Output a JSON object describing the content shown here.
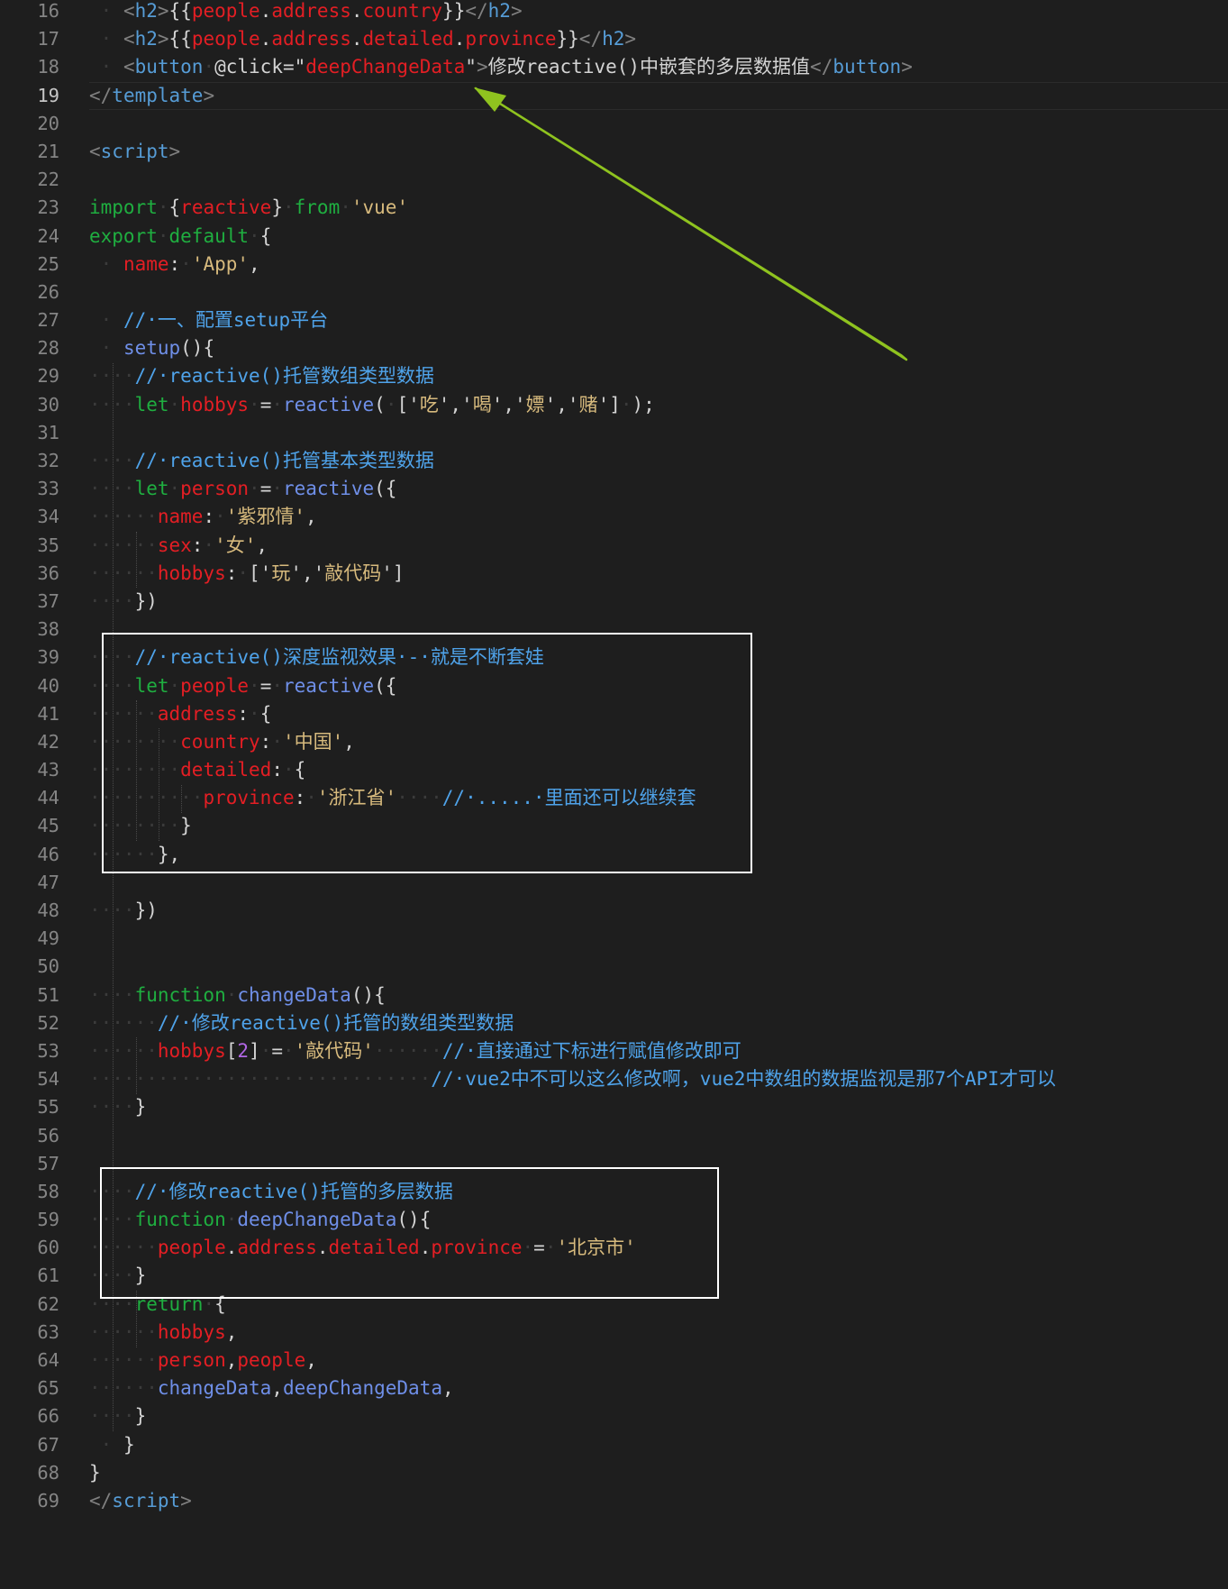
{
  "editor": {
    "lines": [
      {
        "n": "16",
        "t": [
          [
            "ws",
            " · "
          ],
          [
            "tag",
            "<"
          ],
          [
            "tn",
            "h2"
          ],
          [
            "tag",
            ">"
          ],
          [
            "pl",
            "{{"
          ],
          [
            "var",
            "people"
          ],
          [
            "pl",
            "."
          ],
          [
            "var",
            "address"
          ],
          [
            "pl",
            "."
          ],
          [
            "var",
            "country"
          ],
          [
            "pl",
            "}}"
          ],
          [
            "tag",
            "</"
          ],
          [
            "tn",
            "h2"
          ],
          [
            "tag",
            ">"
          ]
        ]
      },
      {
        "n": "17",
        "t": [
          [
            "ws",
            " · "
          ],
          [
            "tag",
            "<"
          ],
          [
            "tn",
            "h2"
          ],
          [
            "tag",
            ">"
          ],
          [
            "pl",
            "{{"
          ],
          [
            "var",
            "people"
          ],
          [
            "pl",
            "."
          ],
          [
            "var",
            "address"
          ],
          [
            "pl",
            "."
          ],
          [
            "var",
            "detailed"
          ],
          [
            "pl",
            "."
          ],
          [
            "var",
            "province"
          ],
          [
            "pl",
            "}}"
          ],
          [
            "tag",
            "</"
          ],
          [
            "tn",
            "h2"
          ],
          [
            "tag",
            ">"
          ]
        ]
      },
      {
        "n": "18",
        "t": [
          [
            "ws",
            " · "
          ],
          [
            "tag",
            "<"
          ],
          [
            "tn",
            "button"
          ],
          [
            "ws",
            "·"
          ],
          [
            "pl",
            "@click="
          ],
          [
            "pl",
            "\""
          ],
          [
            "var",
            "deepChangeData"
          ],
          [
            "pl",
            "\""
          ],
          [
            "tag",
            ">"
          ],
          [
            "txt",
            "修改reactive()中嵌套的多层数据值"
          ],
          [
            "tag",
            "</"
          ],
          [
            "tn",
            "button"
          ],
          [
            "tag",
            ">"
          ]
        ]
      },
      {
        "n": "19",
        "current": true,
        "t": [
          [
            "tag",
            "</"
          ],
          [
            "tn",
            "template"
          ],
          [
            "tag",
            ">"
          ]
        ]
      },
      {
        "n": "20",
        "t": []
      },
      {
        "n": "21",
        "t": [
          [
            "tag",
            "<"
          ],
          [
            "tn",
            "script"
          ],
          [
            "tag",
            ">"
          ]
        ]
      },
      {
        "n": "22",
        "t": []
      },
      {
        "n": "23",
        "t": [
          [
            "kw",
            "import"
          ],
          [
            "ws",
            "·"
          ],
          [
            "pl",
            "{"
          ],
          [
            "var",
            "reactive"
          ],
          [
            "pl",
            "}"
          ],
          [
            "ws",
            "·"
          ],
          [
            "kw",
            "from"
          ],
          [
            "ws",
            "·"
          ],
          [
            "str",
            "'vue'"
          ]
        ]
      },
      {
        "n": "24",
        "t": [
          [
            "kw",
            "export"
          ],
          [
            "ws",
            "·"
          ],
          [
            "kw",
            "default"
          ],
          [
            "ws",
            "·"
          ],
          [
            "pl",
            "{"
          ]
        ]
      },
      {
        "n": "25",
        "t": [
          [
            "ws",
            " · "
          ],
          [
            "var",
            "name"
          ],
          [
            "pl",
            ":"
          ],
          [
            "ws",
            "·"
          ],
          [
            "str",
            "'App'"
          ],
          [
            "pl",
            ","
          ]
        ]
      },
      {
        "n": "26",
        "t": []
      },
      {
        "n": "27",
        "t": [
          [
            "ws",
            " · "
          ],
          [
            "cm",
            "//·一、配置setup平台"
          ]
        ]
      },
      {
        "n": "28",
        "t": [
          [
            "ws",
            " · "
          ],
          [
            "fn",
            "setup"
          ],
          [
            "pl",
            "(){"
          ]
        ]
      },
      {
        "n": "29",
        "t": [
          [
            "ws",
            "····"
          ],
          [
            "cm",
            "//·reactive()托管数组类型数据"
          ]
        ]
      },
      {
        "n": "30",
        "t": [
          [
            "ws",
            "····"
          ],
          [
            "kw",
            "let"
          ],
          [
            "ws",
            "·"
          ],
          [
            "var",
            "hobbys"
          ],
          [
            "ws",
            "·"
          ],
          [
            "pl",
            "="
          ],
          [
            "ws",
            "·"
          ],
          [
            "fn",
            "reactive"
          ],
          [
            "pl",
            "("
          ],
          [
            "ws",
            "·"
          ],
          [
            "pl",
            "['"
          ],
          [
            "str",
            "吃"
          ],
          [
            "pl",
            "','"
          ],
          [
            "str",
            "喝"
          ],
          [
            "pl",
            "','"
          ],
          [
            "str",
            "嫖"
          ],
          [
            "pl",
            "','"
          ],
          [
            "str",
            "赌"
          ],
          [
            "pl",
            "']"
          ],
          [
            "ws",
            "·"
          ],
          [
            "pl",
            ");"
          ]
        ]
      },
      {
        "n": "31",
        "t": []
      },
      {
        "n": "32",
        "t": [
          [
            "ws",
            "····"
          ],
          [
            "cm",
            "//·reactive()托管基本类型数据"
          ]
        ]
      },
      {
        "n": "33",
        "t": [
          [
            "ws",
            "····"
          ],
          [
            "kw",
            "let"
          ],
          [
            "ws",
            "·"
          ],
          [
            "var",
            "person"
          ],
          [
            "ws",
            "·"
          ],
          [
            "pl",
            "="
          ],
          [
            "ws",
            "·"
          ],
          [
            "fn",
            "reactive"
          ],
          [
            "pl",
            "({"
          ]
        ]
      },
      {
        "n": "34",
        "t": [
          [
            "ws",
            "······"
          ],
          [
            "var",
            "name"
          ],
          [
            "pl",
            ":"
          ],
          [
            "ws",
            "·"
          ],
          [
            "str",
            "'紫邪情'"
          ],
          [
            "pl",
            ","
          ]
        ]
      },
      {
        "n": "35",
        "t": [
          [
            "ws",
            "······"
          ],
          [
            "var",
            "sex"
          ],
          [
            "pl",
            ":"
          ],
          [
            "ws",
            "·"
          ],
          [
            "str",
            "'女'"
          ],
          [
            "pl",
            ","
          ]
        ]
      },
      {
        "n": "36",
        "t": [
          [
            "ws",
            "······"
          ],
          [
            "var",
            "hobbys"
          ],
          [
            "pl",
            ":"
          ],
          [
            "ws",
            "·"
          ],
          [
            "pl",
            "['"
          ],
          [
            "str",
            "玩"
          ],
          [
            "pl",
            "','"
          ],
          [
            "str",
            "敲代码"
          ],
          [
            "pl",
            "']"
          ]
        ]
      },
      {
        "n": "37",
        "t": [
          [
            "ws",
            "····"
          ],
          [
            "pl",
            "})"
          ]
        ]
      },
      {
        "n": "38",
        "t": []
      },
      {
        "n": "39",
        "t": [
          [
            "ws",
            "····"
          ],
          [
            "cm",
            "//·reactive()深度监视效果·-·就是不断套娃"
          ]
        ]
      },
      {
        "n": "40",
        "t": [
          [
            "ws",
            "····"
          ],
          [
            "kw",
            "let"
          ],
          [
            "ws",
            "·"
          ],
          [
            "var",
            "people"
          ],
          [
            "ws",
            "·"
          ],
          [
            "pl",
            "="
          ],
          [
            "ws",
            "·"
          ],
          [
            "fn",
            "reactive"
          ],
          [
            "pl",
            "({"
          ]
        ]
      },
      {
        "n": "41",
        "t": [
          [
            "ws",
            "······"
          ],
          [
            "var",
            "address"
          ],
          [
            "pl",
            ":"
          ],
          [
            "ws",
            "·"
          ],
          [
            "pl",
            "{"
          ]
        ]
      },
      {
        "n": "42",
        "t": [
          [
            "ws",
            "········"
          ],
          [
            "var",
            "country"
          ],
          [
            "pl",
            ":"
          ],
          [
            "ws",
            "·"
          ],
          [
            "str",
            "'中国'"
          ],
          [
            "pl",
            ","
          ]
        ]
      },
      {
        "n": "43",
        "t": [
          [
            "ws",
            "········"
          ],
          [
            "var",
            "detailed"
          ],
          [
            "pl",
            ":"
          ],
          [
            "ws",
            "·"
          ],
          [
            "pl",
            "{"
          ]
        ]
      },
      {
        "n": "44",
        "t": [
          [
            "ws",
            "··········"
          ],
          [
            "var",
            "province"
          ],
          [
            "pl",
            ":"
          ],
          [
            "ws",
            "·"
          ],
          [
            "str",
            "'浙江省'"
          ],
          [
            "ws",
            "····"
          ],
          [
            "cm",
            "//·.....·里面还可以继续套"
          ]
        ]
      },
      {
        "n": "45",
        "t": [
          [
            "ws",
            "········"
          ],
          [
            "pl",
            "}"
          ]
        ]
      },
      {
        "n": "46",
        "t": [
          [
            "ws",
            "······"
          ],
          [
            "pl",
            "},"
          ]
        ]
      },
      {
        "n": "47",
        "t": []
      },
      {
        "n": "48",
        "t": [
          [
            "ws",
            "····"
          ],
          [
            "pl",
            "})"
          ]
        ]
      },
      {
        "n": "49",
        "t": []
      },
      {
        "n": "50",
        "t": []
      },
      {
        "n": "51",
        "t": [
          [
            "ws",
            "····"
          ],
          [
            "kw",
            "function"
          ],
          [
            "ws",
            "·"
          ],
          [
            "fn",
            "changeData"
          ],
          [
            "pl",
            "(){"
          ]
        ]
      },
      {
        "n": "52",
        "t": [
          [
            "ws",
            "······"
          ],
          [
            "cm",
            "//·修改reactive()托管的数组类型数据"
          ]
        ]
      },
      {
        "n": "53",
        "t": [
          [
            "ws",
            "······"
          ],
          [
            "var",
            "hobbys"
          ],
          [
            "pl",
            "["
          ],
          [
            "num",
            "2"
          ],
          [
            "pl",
            "]"
          ],
          [
            "ws",
            "·"
          ],
          [
            "pl",
            "="
          ],
          [
            "ws",
            "·"
          ],
          [
            "str",
            "'敲代码'"
          ],
          [
            "ws",
            "······"
          ],
          [
            "cm",
            "//·直接通过下标进行赋值修改即可"
          ]
        ]
      },
      {
        "n": "54",
        "t": [
          [
            "ws",
            "······························"
          ],
          [
            "cm",
            "//·vue2中不可以这么修改啊，vue2中数组的数据监视是那7个API才可以"
          ]
        ]
      },
      {
        "n": "55",
        "t": [
          [
            "ws",
            "····"
          ],
          [
            "pl",
            "}"
          ]
        ]
      },
      {
        "n": "56",
        "t": []
      },
      {
        "n": "57",
        "t": []
      },
      {
        "n": "58",
        "t": [
          [
            "ws",
            "····"
          ],
          [
            "cm",
            "//·修改reactive()托管的多层数据"
          ]
        ]
      },
      {
        "n": "59",
        "t": [
          [
            "ws",
            "····"
          ],
          [
            "kw",
            "function"
          ],
          [
            "ws",
            "·"
          ],
          [
            "fn",
            "deepChangeData"
          ],
          [
            "pl",
            "(){"
          ]
        ]
      },
      {
        "n": "60",
        "t": [
          [
            "ws",
            "······"
          ],
          [
            "var",
            "people"
          ],
          [
            "pl",
            "."
          ],
          [
            "var",
            "address"
          ],
          [
            "pl",
            "."
          ],
          [
            "var",
            "detailed"
          ],
          [
            "pl",
            "."
          ],
          [
            "var",
            "province"
          ],
          [
            "ws",
            "·"
          ],
          [
            "pl",
            "="
          ],
          [
            "ws",
            "·"
          ],
          [
            "str",
            "'北京市'"
          ]
        ]
      },
      {
        "n": "61",
        "t": [
          [
            "ws",
            "····"
          ],
          [
            "pl",
            "}"
          ]
        ]
      },
      {
        "n": "62",
        "t": [
          [
            "ws",
            "····"
          ],
          [
            "kw",
            "return"
          ],
          [
            "ws",
            "·"
          ],
          [
            "pl",
            "{"
          ]
        ]
      },
      {
        "n": "63",
        "t": [
          [
            "ws",
            "······"
          ],
          [
            "var",
            "hobbys"
          ],
          [
            "pl",
            ","
          ]
        ]
      },
      {
        "n": "64",
        "t": [
          [
            "ws",
            "······"
          ],
          [
            "var",
            "person"
          ],
          [
            "pl",
            ","
          ],
          [
            "var",
            "people"
          ],
          [
            "pl",
            ","
          ]
        ]
      },
      {
        "n": "65",
        "t": [
          [
            "ws",
            "······"
          ],
          [
            "fn",
            "changeData"
          ],
          [
            "pl",
            ","
          ],
          [
            "fn",
            "deepChangeData"
          ],
          [
            "pl",
            ","
          ]
        ]
      },
      {
        "n": "66",
        "t": [
          [
            "ws",
            "····"
          ],
          [
            "pl",
            "}"
          ]
        ]
      },
      {
        "n": "67",
        "t": [
          [
            "ws",
            " · "
          ],
          [
            "pl",
            "}"
          ]
        ]
      },
      {
        "n": "68",
        "t": [
          [
            "pl",
            "}"
          ]
        ]
      },
      {
        "n": "69",
        "t": [
          [
            "tag",
            "</"
          ],
          [
            "tn",
            "script"
          ],
          [
            "tag",
            ">"
          ]
        ]
      }
    ]
  },
  "colors": {
    "background": "#1e1e1e",
    "annotation_box": "#ffffff",
    "annotation_arrow": "#8fc31f"
  }
}
